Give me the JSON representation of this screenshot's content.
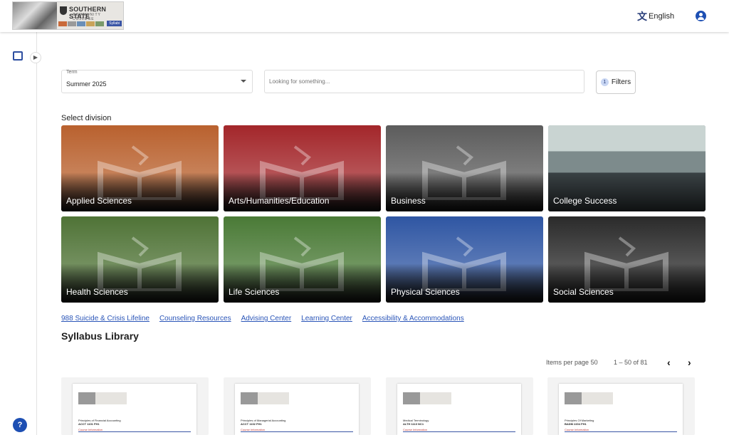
{
  "header": {
    "logo": {
      "line1": "SOUTHERN STATE",
      "line2": "COMMUNITY COLLEGE",
      "tag": "Syllabi"
    },
    "language": "English",
    "icons": {
      "language": "translate-icon",
      "account": "account-circle-icon"
    }
  },
  "sidebar": {
    "help_label": "?"
  },
  "filters": {
    "term_label": "Term",
    "term_value": "Summer 2025",
    "search_placeholder": "Looking for something...",
    "filters_label": "Filters",
    "filters_count": "1"
  },
  "divisions": {
    "title": "Select division",
    "items": [
      {
        "label": "Applied Sciences",
        "color": "#b9612e"
      },
      {
        "label": "Arts/Humanities/Education",
        "color": "#a3262a"
      },
      {
        "label": "Business",
        "color": "#5c5c5c"
      },
      {
        "label": "College Success",
        "color": "#6f7d7e"
      },
      {
        "label": "Health Sciences",
        "color": "#4f7336"
      },
      {
        "label": "Life Sciences",
        "color": "#4a7a36"
      },
      {
        "label": "Physical Sciences",
        "color": "#2f56a3"
      },
      {
        "label": "Social Sciences",
        "color": "#2a2a2a"
      }
    ]
  },
  "links": [
    "988 Suicide & Crisis Lifeline",
    "Counseling Resources",
    "Advising Center",
    "Learning Center",
    "Accessibility & Accommodations"
  ],
  "library": {
    "title": "Syllabus Library",
    "items_per_page_label": "Items per page",
    "items_per_page": "50",
    "range": "1 – 50 of 81",
    "prev_label": "‹",
    "next_label": "›",
    "cards": [
      {
        "course": "Principles of Financial Accounting",
        "code": "ACCT 1101 FH1",
        "section": "Course Information"
      },
      {
        "course": "Principles of Managerial Accounting",
        "code": "ACCT 1102 FH1",
        "section": "Course Information"
      },
      {
        "course": "Medical Terminology",
        "code": "ALTH 1110 NC1",
        "section": "Course Information"
      },
      {
        "course": "Principles Of Marketing",
        "code": "BADM 2204 FH1",
        "section": "Course Information"
      }
    ]
  }
}
